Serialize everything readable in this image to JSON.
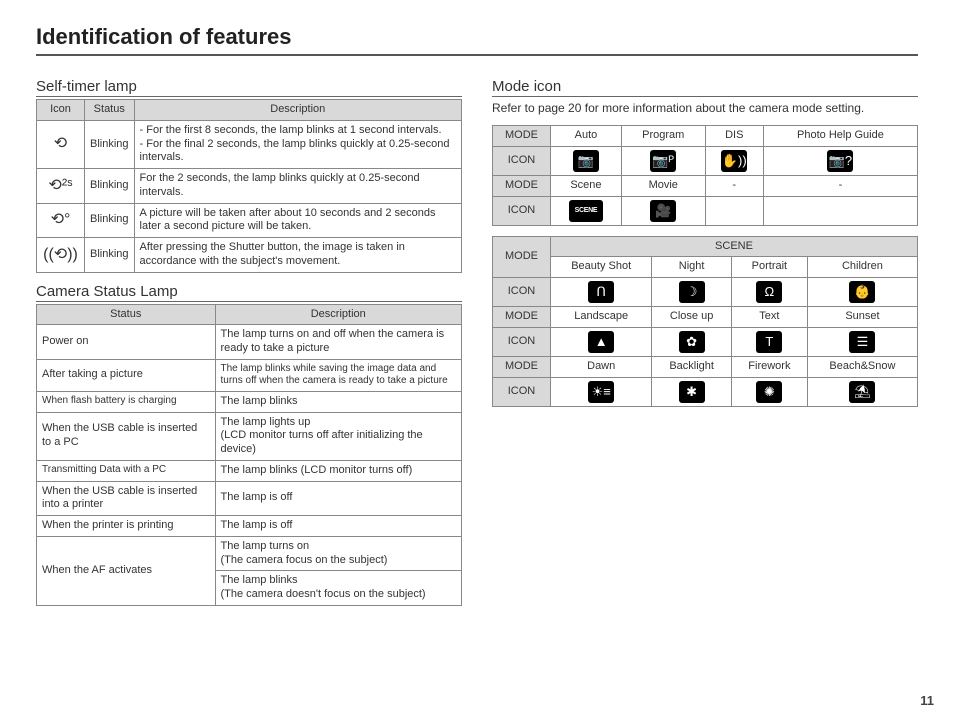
{
  "page_title": "Identification of features",
  "page_number": "11",
  "self_timer": {
    "heading": "Self-timer lamp",
    "cols": {
      "icon": "Icon",
      "status": "Status",
      "desc": "Description"
    },
    "rows": [
      {
        "icon_name": "self-timer-10s-icon",
        "icon_glyph": "⟲",
        "status": "Blinking",
        "desc": "- For the first 8 seconds, the lamp blinks at 1 second intervals.\n- For the final 2 seconds, the lamp blinks quickly at 0.25-second intervals."
      },
      {
        "icon_name": "self-timer-2s-icon",
        "icon_glyph": "⟲²ˢ",
        "status": "Blinking",
        "desc": "For the 2 seconds, the lamp blinks quickly at 0.25-second intervals."
      },
      {
        "icon_name": "self-timer-double-icon",
        "icon_glyph": "⟲°",
        "status": "Blinking",
        "desc": "A picture will be taken after about 10 seconds and 2 seconds later a second picture will be taken."
      },
      {
        "icon_name": "self-timer-motion-icon",
        "icon_glyph": "((⟲))",
        "status": "Blinking",
        "desc": "After pressing the Shutter button, the image is taken in accordance with the subject's movement."
      }
    ]
  },
  "camera_status": {
    "heading": "Camera Status Lamp",
    "cols": {
      "status": "Status",
      "desc": "Description"
    },
    "rows": [
      {
        "status": "Power on",
        "desc": "The lamp turns on and off when the camera is ready to take a picture"
      },
      {
        "status": "After taking a picture",
        "desc": "The lamp blinks while saving the image data and turns off when the camera is ready to take a picture"
      },
      {
        "status": "When flash battery is charging",
        "desc": "The lamp blinks"
      },
      {
        "status": "When the USB cable is inserted to a PC",
        "desc": "The lamp lights up\n(LCD monitor turns off after initializing the device)"
      },
      {
        "status": "Transmitting Data with a PC",
        "desc": "The lamp blinks (LCD monitor turns off)"
      },
      {
        "status": "When the USB cable is inserted into a printer",
        "desc": "The lamp is off"
      },
      {
        "status": "When the printer is printing",
        "desc": "The lamp is off"
      }
    ],
    "af_row": {
      "status": "When the AF activates",
      "desc1": "The lamp turns on\n(The camera focus on the subject)",
      "desc2": "The lamp blinks\n(The camera doesn't focus on the subject)"
    }
  },
  "mode_icon": {
    "heading": "Mode icon",
    "ref": "Refer to page 20 for more information about the camera mode setting.",
    "labels": {
      "mode": "MODE",
      "icon": "ICON"
    },
    "top_modes": [
      [
        "Auto",
        "Program",
        "DIS",
        "Photo Help Guide"
      ],
      [
        "Scene",
        "Movie",
        "-",
        "-"
      ]
    ],
    "top_icons": [
      [
        {
          "name": "auto-icon",
          "glyph": "📷"
        },
        {
          "name": "program-icon",
          "glyph": "📷ᴾ"
        },
        {
          "name": "dis-icon",
          "glyph": "✋))"
        },
        {
          "name": "photo-help-icon",
          "glyph": "📷?"
        }
      ],
      [
        {
          "name": "scene-mode-icon",
          "glyph": "SCENE"
        },
        {
          "name": "movie-icon",
          "glyph": "🎥"
        },
        {
          "name": "blank-icon-1",
          "glyph": ""
        },
        {
          "name": "blank-icon-2",
          "glyph": ""
        }
      ]
    ],
    "scene_header": "SCENE",
    "scene_modes": [
      [
        "Beauty Shot",
        "Night",
        "Portrait",
        "Children"
      ],
      [
        "Landscape",
        "Close up",
        "Text",
        "Sunset"
      ],
      [
        "Dawn",
        "Backlight",
        "Firework",
        "Beach&Snow"
      ]
    ],
    "scene_icons": [
      [
        {
          "name": "beauty-shot-icon",
          "glyph": "ᑎ"
        },
        {
          "name": "night-icon",
          "glyph": "☽"
        },
        {
          "name": "portrait-icon",
          "glyph": "Ω"
        },
        {
          "name": "children-icon",
          "glyph": "👶"
        }
      ],
      [
        {
          "name": "landscape-icon",
          "glyph": "▲"
        },
        {
          "name": "close-up-icon",
          "glyph": "✿"
        },
        {
          "name": "text-icon",
          "glyph": "T"
        },
        {
          "name": "sunset-icon",
          "glyph": "☰"
        }
      ],
      [
        {
          "name": "dawn-icon",
          "glyph": "☀≡"
        },
        {
          "name": "backlight-icon",
          "glyph": "✱"
        },
        {
          "name": "firework-icon",
          "glyph": "✺"
        },
        {
          "name": "beach-snow-icon",
          "glyph": "⛱"
        }
      ]
    ]
  }
}
